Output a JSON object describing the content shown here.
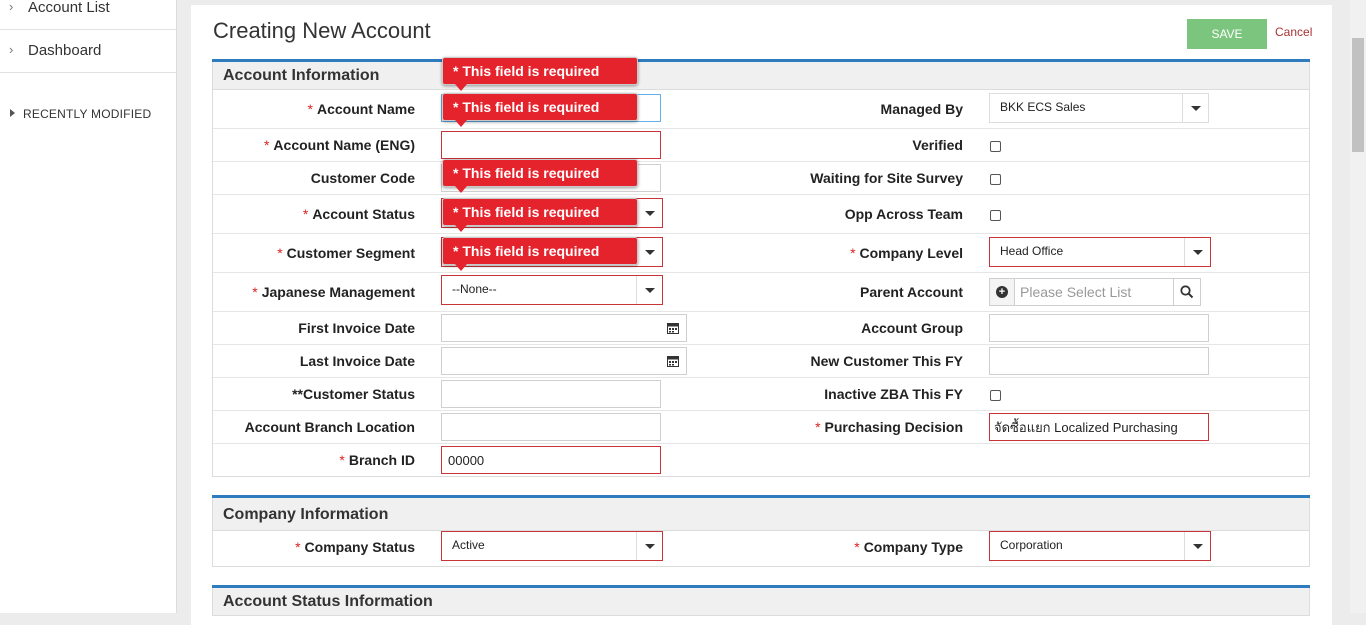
{
  "sidebar": {
    "items": [
      {
        "label": "Account List"
      },
      {
        "label": "Dashboard"
      }
    ],
    "recent_label": "RECENTLY MODIFIED"
  },
  "page": {
    "title": "Creating New Account",
    "save_label": "SAVE",
    "cancel_label": "Cancel"
  },
  "validation_message": "* This field is required",
  "sections": {
    "account_info": {
      "title": "Account Information",
      "left": {
        "account_name": "Account Name",
        "account_name_eng": "Account Name (ENG)",
        "customer_code": "Customer Code",
        "account_status": "Account Status",
        "customer_segment": "Customer Segment",
        "japanese_management": "Japanese Management",
        "japanese_management_value": "--None--",
        "first_invoice_date": "First Invoice Date",
        "last_invoice_date": "Last Invoice Date",
        "customer_status": "**Customer Status",
        "account_branch_location": "Account Branch Location",
        "branch_id": "Branch ID",
        "branch_id_value": "00000"
      },
      "right": {
        "managed_by": "Managed By",
        "managed_by_value": "BKK ECS Sales",
        "verified": "Verified",
        "waiting_site_survey": "Waiting for Site Survey",
        "opp_across_team": "Opp Across Team",
        "company_level": "Company Level",
        "company_level_value": "Head Office",
        "parent_account": "Parent Account",
        "parent_account_placeholder": "Please Select List",
        "account_group": "Account Group",
        "new_customer_fy": "New Customer This FY",
        "inactive_zba_fy": "Inactive ZBA This FY",
        "purchasing_decision": "Purchasing Decision",
        "purchasing_decision_value": "จัดซื้อแยก Localized Purchasing"
      }
    },
    "company_info": {
      "title": "Company Information",
      "company_status": "Company Status",
      "company_status_value": "Active",
      "company_type": "Company Type",
      "company_type_value": "Corporation"
    },
    "account_status_info": {
      "title": "Account Status Information"
    }
  },
  "icons": {
    "chevron": "chevron-right-icon",
    "calendar": "calendar-icon",
    "search": "search-icon",
    "add": "add-circle-icon",
    "dropdown": "chevron-down-icon"
  }
}
